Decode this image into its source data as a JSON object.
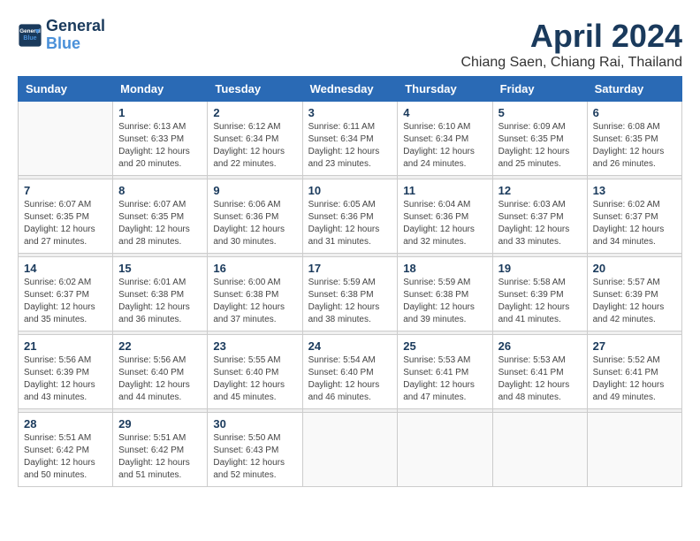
{
  "header": {
    "logo_line1": "General",
    "logo_line2": "Blue",
    "main_title": "April 2024",
    "subtitle": "Chiang Saen, Chiang Rai, Thailand"
  },
  "calendar": {
    "weekdays": [
      "Sunday",
      "Monday",
      "Tuesday",
      "Wednesday",
      "Thursday",
      "Friday",
      "Saturday"
    ],
    "weeks": [
      [
        {
          "day": "",
          "info": ""
        },
        {
          "day": "1",
          "info": "Sunrise: 6:13 AM\nSunset: 6:33 PM\nDaylight: 12 hours\nand 20 minutes."
        },
        {
          "day": "2",
          "info": "Sunrise: 6:12 AM\nSunset: 6:34 PM\nDaylight: 12 hours\nand 22 minutes."
        },
        {
          "day": "3",
          "info": "Sunrise: 6:11 AM\nSunset: 6:34 PM\nDaylight: 12 hours\nand 23 minutes."
        },
        {
          "day": "4",
          "info": "Sunrise: 6:10 AM\nSunset: 6:34 PM\nDaylight: 12 hours\nand 24 minutes."
        },
        {
          "day": "5",
          "info": "Sunrise: 6:09 AM\nSunset: 6:35 PM\nDaylight: 12 hours\nand 25 minutes."
        },
        {
          "day": "6",
          "info": "Sunrise: 6:08 AM\nSunset: 6:35 PM\nDaylight: 12 hours\nand 26 minutes."
        }
      ],
      [
        {
          "day": "7",
          "info": "Sunrise: 6:07 AM\nSunset: 6:35 PM\nDaylight: 12 hours\nand 27 minutes."
        },
        {
          "day": "8",
          "info": "Sunrise: 6:07 AM\nSunset: 6:35 PM\nDaylight: 12 hours\nand 28 minutes."
        },
        {
          "day": "9",
          "info": "Sunrise: 6:06 AM\nSunset: 6:36 PM\nDaylight: 12 hours\nand 30 minutes."
        },
        {
          "day": "10",
          "info": "Sunrise: 6:05 AM\nSunset: 6:36 PM\nDaylight: 12 hours\nand 31 minutes."
        },
        {
          "day": "11",
          "info": "Sunrise: 6:04 AM\nSunset: 6:36 PM\nDaylight: 12 hours\nand 32 minutes."
        },
        {
          "day": "12",
          "info": "Sunrise: 6:03 AM\nSunset: 6:37 PM\nDaylight: 12 hours\nand 33 minutes."
        },
        {
          "day": "13",
          "info": "Sunrise: 6:02 AM\nSunset: 6:37 PM\nDaylight: 12 hours\nand 34 minutes."
        }
      ],
      [
        {
          "day": "14",
          "info": "Sunrise: 6:02 AM\nSunset: 6:37 PM\nDaylight: 12 hours\nand 35 minutes."
        },
        {
          "day": "15",
          "info": "Sunrise: 6:01 AM\nSunset: 6:38 PM\nDaylight: 12 hours\nand 36 minutes."
        },
        {
          "day": "16",
          "info": "Sunrise: 6:00 AM\nSunset: 6:38 PM\nDaylight: 12 hours\nand 37 minutes."
        },
        {
          "day": "17",
          "info": "Sunrise: 5:59 AM\nSunset: 6:38 PM\nDaylight: 12 hours\nand 38 minutes."
        },
        {
          "day": "18",
          "info": "Sunrise: 5:59 AM\nSunset: 6:38 PM\nDaylight: 12 hours\nand 39 minutes."
        },
        {
          "day": "19",
          "info": "Sunrise: 5:58 AM\nSunset: 6:39 PM\nDaylight: 12 hours\nand 41 minutes."
        },
        {
          "day": "20",
          "info": "Sunrise: 5:57 AM\nSunset: 6:39 PM\nDaylight: 12 hours\nand 42 minutes."
        }
      ],
      [
        {
          "day": "21",
          "info": "Sunrise: 5:56 AM\nSunset: 6:39 PM\nDaylight: 12 hours\nand 43 minutes."
        },
        {
          "day": "22",
          "info": "Sunrise: 5:56 AM\nSunset: 6:40 PM\nDaylight: 12 hours\nand 44 minutes."
        },
        {
          "day": "23",
          "info": "Sunrise: 5:55 AM\nSunset: 6:40 PM\nDaylight: 12 hours\nand 45 minutes."
        },
        {
          "day": "24",
          "info": "Sunrise: 5:54 AM\nSunset: 6:40 PM\nDaylight: 12 hours\nand 46 minutes."
        },
        {
          "day": "25",
          "info": "Sunrise: 5:53 AM\nSunset: 6:41 PM\nDaylight: 12 hours\nand 47 minutes."
        },
        {
          "day": "26",
          "info": "Sunrise: 5:53 AM\nSunset: 6:41 PM\nDaylight: 12 hours\nand 48 minutes."
        },
        {
          "day": "27",
          "info": "Sunrise: 5:52 AM\nSunset: 6:41 PM\nDaylight: 12 hours\nand 49 minutes."
        }
      ],
      [
        {
          "day": "28",
          "info": "Sunrise: 5:51 AM\nSunset: 6:42 PM\nDaylight: 12 hours\nand 50 minutes."
        },
        {
          "day": "29",
          "info": "Sunrise: 5:51 AM\nSunset: 6:42 PM\nDaylight: 12 hours\nand 51 minutes."
        },
        {
          "day": "30",
          "info": "Sunrise: 5:50 AM\nSunset: 6:43 PM\nDaylight: 12 hours\nand 52 minutes."
        },
        {
          "day": "",
          "info": ""
        },
        {
          "day": "",
          "info": ""
        },
        {
          "day": "",
          "info": ""
        },
        {
          "day": "",
          "info": ""
        }
      ]
    ]
  }
}
